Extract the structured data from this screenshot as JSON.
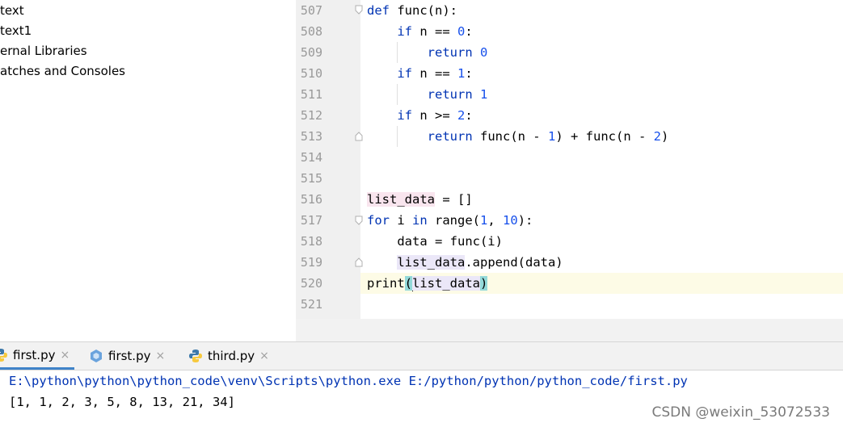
{
  "project_tree": {
    "items": [
      "text",
      "text1",
      "ernal Libraries",
      "atches and Consoles"
    ]
  },
  "editor": {
    "line_numbers": [
      "507",
      "508",
      "509",
      "510",
      "511",
      "512",
      "513",
      "514",
      "515",
      "516",
      "517",
      "518",
      "519",
      "520",
      "521"
    ],
    "code": {
      "l507": {
        "kw": "def",
        "rest": " func(n):"
      },
      "l508": {
        "kw": "if",
        "rest": " n == ",
        "num": "0",
        "tail": ":"
      },
      "l509": {
        "kw": "return",
        "num": "0"
      },
      "l510": {
        "kw": "if",
        "rest": " n == ",
        "num": "1",
        "tail": ":"
      },
      "l511": {
        "kw": "return",
        "num": "1"
      },
      "l512": {
        "kw": "if",
        "rest": " n >= ",
        "num": "2",
        "tail": ":"
      },
      "l513": {
        "kw": "return",
        "a": " func(n - ",
        "n1": "1",
        "b": ") + func(n - ",
        "n2": "2",
        "c": ")"
      },
      "l516": {
        "var": "list_data",
        "rest": " = []"
      },
      "l517": {
        "kw1": "for",
        "a": " i ",
        "kw2": "in",
        "b": " range(",
        "n1": "1",
        "c": ", ",
        "n2": "10",
        "d": "):"
      },
      "l518": {
        "text": "data = func(i)"
      },
      "l519": {
        "var": "list_data",
        "rest": ".append(data)"
      },
      "l520": {
        "fn": "print",
        "open": "(",
        "var": "list_data",
        "close": ")"
      }
    }
  },
  "run_tabs": [
    {
      "label": "first.py",
      "close": "×",
      "icon": "python-icon"
    },
    {
      "label": "first.py",
      "close": "×",
      "icon": "python-config-icon"
    },
    {
      "label": "third.py",
      "close": "×",
      "icon": "python-icon"
    }
  ],
  "console": {
    "command": "E:\\python\\python\\python_code\\venv\\Scripts\\python.exe E:/python/python/python_code/first.py",
    "output": "[1, 1, 2, 3, 5, 8, 13, 21, 34]"
  },
  "watermark": "CSDN @weixin_53072533",
  "colors": {
    "keyword": "#0033b3",
    "number": "#1750eb",
    "current_line": "#fdfbe6",
    "brace_match": "#93d9d9",
    "tab_underline": "#4083c9"
  }
}
